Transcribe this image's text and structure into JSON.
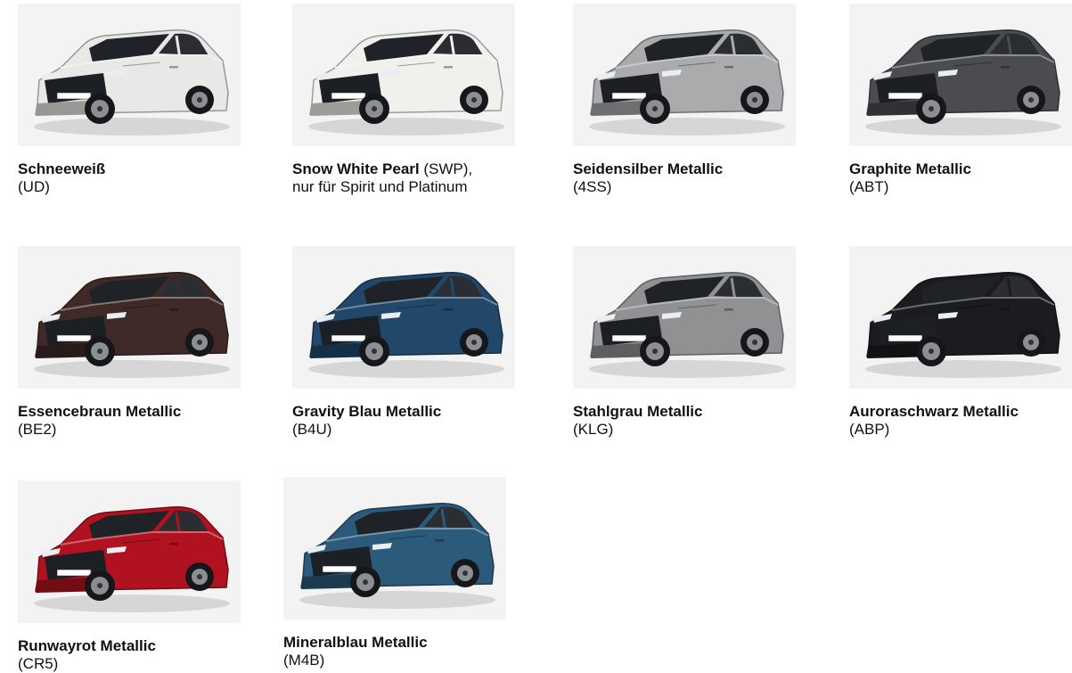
{
  "colors": [
    {
      "name": "Schneeweiß",
      "code": "(UD)",
      "note": "",
      "paint": "#e8e8e6"
    },
    {
      "name": "Snow White Pearl",
      "code": "(SWP),",
      "note": "nur für Spirit und Platinum",
      "paint": "#f0f0ec"
    },
    {
      "name": "Seidensilber Metallic",
      "code": "(4SS)",
      "note": "",
      "paint": "#a9abad"
    },
    {
      "name": "Graphite Metallic",
      "code": "(ABT)",
      "note": "",
      "paint": "#4a4c50"
    },
    {
      "name": "Essencebraun Metallic",
      "code": "(BE2)",
      "note": "",
      "paint": "#3f2a27"
    },
    {
      "name": "Gravity Blau Metallic",
      "code": "(B4U)",
      "note": "",
      "paint": "#21486b"
    },
    {
      "name": "Stahlgrau Metallic",
      "code": "(KLG)",
      "note": "",
      "paint": "#8f9193"
    },
    {
      "name": "Auroraschwarz Metallic",
      "code": "(ABP)",
      "note": "",
      "paint": "#1b1c1f"
    },
    {
      "name": "Runwayrot Metallic",
      "code": "(CR5)",
      "note": "",
      "paint": "#b1121f"
    },
    {
      "name": "Mineralblau Metallic",
      "code": "(M4B)",
      "note": "",
      "paint": "#2b5a7a"
    }
  ]
}
